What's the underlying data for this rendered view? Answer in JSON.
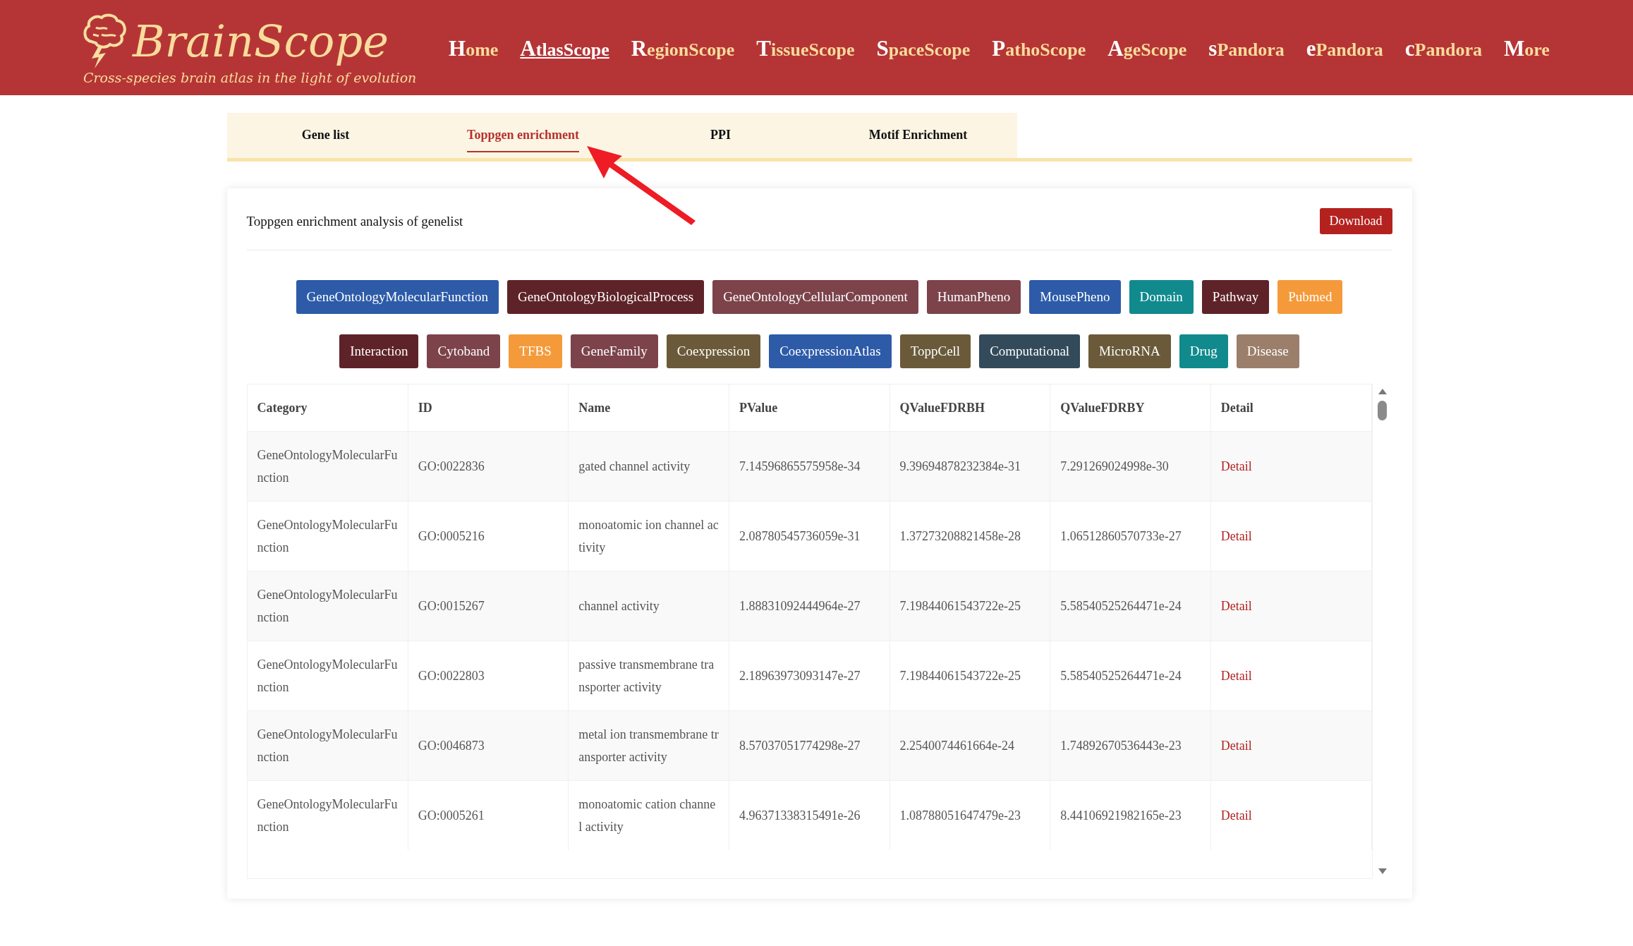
{
  "header": {
    "logo_title": "BrainScope",
    "tagline": "Cross-species brain atlas in the light of evolution",
    "nav": [
      {
        "label": "Home",
        "selected": false
      },
      {
        "label": "AtlasScope",
        "selected": true
      },
      {
        "label": "RegionScope",
        "selected": false
      },
      {
        "label": "TissueScope",
        "selected": false
      },
      {
        "label": "SpaceScope",
        "selected": false
      },
      {
        "label": "PathoScope",
        "selected": false
      },
      {
        "label": "AgeScope",
        "selected": false
      },
      {
        "label": "sPandora",
        "selected": false
      },
      {
        "label": "ePandora",
        "selected": false
      },
      {
        "label": "cPandora",
        "selected": false
      },
      {
        "label": "More",
        "selected": false
      }
    ]
  },
  "tabs": [
    {
      "label": "Gene list",
      "selected": false
    },
    {
      "label": "Toppgen enrichment",
      "selected": true
    },
    {
      "label": "PPI",
      "selected": false
    },
    {
      "label": "Motif Enrichment",
      "selected": false
    }
  ],
  "panel": {
    "title": "Toppgen enrichment analysis of genelist",
    "download_button": "Download",
    "category_rows": [
      [
        {
          "label": "GeneOntologyMolecularFunction",
          "color": "#2d5ba8"
        },
        {
          "label": "GeneOntologyBiologicalProcess",
          "color": "#5e2328"
        },
        {
          "label": "GeneOntologyCellularComponent",
          "color": "#7c434b"
        },
        {
          "label": "HumanPheno",
          "color": "#7c434b"
        },
        {
          "label": "MousePheno",
          "color": "#2d5ba8"
        },
        {
          "label": "Domain",
          "color": "#118a8e"
        },
        {
          "label": "Pathway",
          "color": "#5e2328"
        },
        {
          "label": "Pubmed",
          "color": "#f59a3a"
        }
      ],
      [
        {
          "label": "Interaction",
          "color": "#5e2328"
        },
        {
          "label": "Cytoband",
          "color": "#7c434b"
        },
        {
          "label": "TFBS",
          "color": "#f59a3a"
        },
        {
          "label": "GeneFamily",
          "color": "#7c434b"
        },
        {
          "label": "Coexpression",
          "color": "#6b5a3a"
        },
        {
          "label": "CoexpressionAtlas",
          "color": "#2d5ba8"
        },
        {
          "label": "ToppCell",
          "color": "#6b5a3a"
        },
        {
          "label": "Computational",
          "color": "#334a5a"
        },
        {
          "label": "MicroRNA",
          "color": "#6b5a3a"
        },
        {
          "label": "Drug",
          "color": "#118a8e"
        },
        {
          "label": "Disease",
          "color": "#9b7f6a"
        }
      ]
    ],
    "table": {
      "columns": [
        "Category",
        "ID",
        "Name",
        "PValue",
        "QValueFDRBH",
        "QValueFDRBY",
        "Detail"
      ],
      "rows": [
        [
          "GeneOntologyMolecularFunction",
          "GO:0022836",
          "gated channel activity",
          "7.14596865575958e-34",
          "9.39694878232384e-31",
          "7.291269024998e-30",
          "Detail"
        ],
        [
          "GeneOntologyMolecularFunction",
          "GO:0005216",
          "monoatomic ion channel activity",
          "2.08780545736059e-31",
          "1.37273208821458e-28",
          "1.06512860570733e-27",
          "Detail"
        ],
        [
          "GeneOntologyMolecularFunction",
          "GO:0015267",
          "channel activity",
          "1.88831092444964e-27",
          "7.19844061543722e-25",
          "5.58540525264471e-24",
          "Detail"
        ],
        [
          "GeneOntologyMolecularFunction",
          "GO:0022803",
          "passive transmembrane transporter activity",
          "2.18963973093147e-27",
          "7.19844061543722e-25",
          "5.58540525264471e-24",
          "Detail"
        ],
        [
          "GeneOntologyMolecularFunction",
          "GO:0046873",
          "metal ion transmembrane transporter activity",
          "8.57037051774298e-27",
          "2.2540074461664e-24",
          "1.74892670536443e-23",
          "Detail"
        ],
        [
          "GeneOntologyMolecularFunction",
          "GO:0005261",
          "monoatomic cation channel activity",
          "4.96371338315491e-26",
          "1.08788051647479e-23",
          "8.44106921982165e-23",
          "Detail"
        ]
      ]
    }
  }
}
